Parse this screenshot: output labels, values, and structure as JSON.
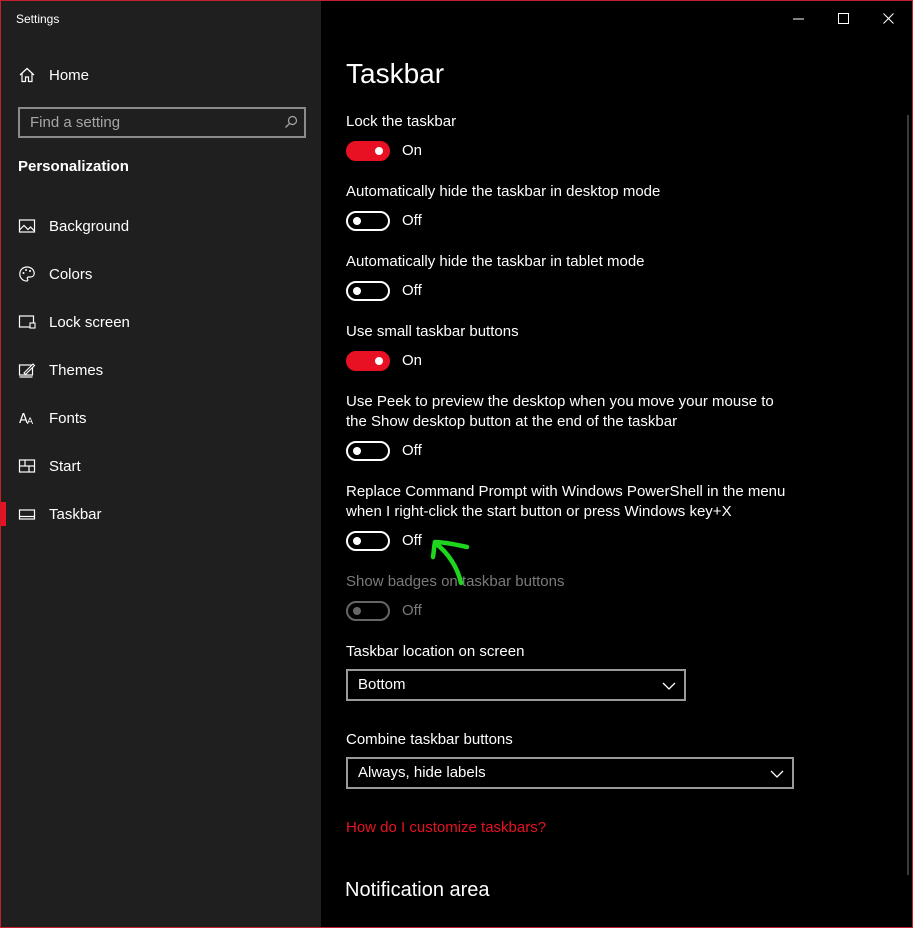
{
  "window": {
    "title": "Settings"
  },
  "sidebar": {
    "home_label": "Home",
    "search": {
      "placeholder": "Find a setting"
    },
    "section_heading": "Personalization",
    "items": [
      {
        "label": "Background",
        "icon": "picture-icon",
        "selected": false
      },
      {
        "label": "Colors",
        "icon": "palette-icon",
        "selected": false
      },
      {
        "label": "Lock screen",
        "icon": "lock-screen-icon",
        "selected": false
      },
      {
        "label": "Themes",
        "icon": "themes-icon",
        "selected": false
      },
      {
        "label": "Fonts",
        "icon": "fonts-icon",
        "selected": false
      },
      {
        "label": "Start",
        "icon": "start-icon",
        "selected": false
      },
      {
        "label": "Taskbar",
        "icon": "taskbar-icon",
        "selected": true
      }
    ]
  },
  "main": {
    "title": "Taskbar",
    "settings": [
      {
        "label": "Lock the taskbar",
        "state": "On",
        "on": true,
        "disabled": false
      },
      {
        "label": "Automatically hide the taskbar in desktop mode",
        "state": "Off",
        "on": false,
        "disabled": false
      },
      {
        "label": "Automatically hide the taskbar in tablet mode",
        "state": "Off",
        "on": false,
        "disabled": false
      },
      {
        "label": "Use small taskbar buttons",
        "state": "On",
        "on": true,
        "disabled": false
      },
      {
        "label_line1": "Use Peek to preview the desktop when you move your mouse to",
        "label_line2": "the Show desktop button at the end of the taskbar",
        "state": "Off",
        "on": false,
        "disabled": false
      },
      {
        "label_line1": "Replace Command Prompt with Windows PowerShell in the menu",
        "label_line2": "when I right-click the start button or press Windows key+X",
        "state": "Off",
        "on": false,
        "disabled": false
      },
      {
        "label": "Show badges on taskbar buttons",
        "state": "Off",
        "on": false,
        "disabled": true
      }
    ],
    "location": {
      "label": "Taskbar location on screen",
      "value": "Bottom"
    },
    "combine": {
      "label": "Combine taskbar buttons",
      "value": "Always, hide labels"
    },
    "help_link": "How do I customize taskbars?",
    "notification_heading": "Notification area"
  },
  "colors": {
    "accent": "#e81123",
    "sidebar_bg": "#1f1f1f",
    "content_bg": "#000000",
    "annotation": "#1ed61e"
  }
}
